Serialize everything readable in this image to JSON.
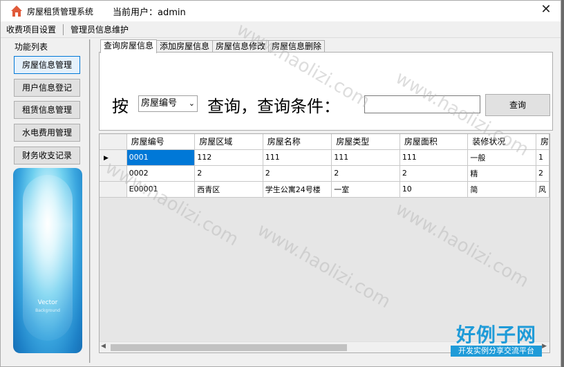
{
  "window": {
    "title": "房屋租赁管理系统",
    "user_label": "当前用户：admin",
    "close_glyph": "✕"
  },
  "menu": {
    "items": [
      "收费项目设置",
      "管理员信息维护"
    ]
  },
  "left_panel": {
    "title": "功能列表",
    "buttons": [
      "房屋信息管理",
      "用户信息登记",
      "租赁信息管理",
      "水电费用管理",
      "财务收支记录"
    ],
    "art_label": "Vector",
    "art_sublabel": "Background"
  },
  "tabs": [
    "查询房屋信息",
    "添加房屋信息",
    "房屋信息修改",
    "房屋信息删除"
  ],
  "query": {
    "prefix": "按",
    "field_selected": "房屋编号",
    "condition_label": "查询，查询条件：",
    "input_value": "",
    "button_label": "查询"
  },
  "grid": {
    "columns": [
      "房屋编号",
      "房屋区域",
      "房屋名称",
      "房屋类型",
      "房屋面积",
      "装修状况",
      "房"
    ],
    "rows": [
      [
        "0001",
        "112",
        "111",
        "111",
        "111",
        "一般",
        "1"
      ],
      [
        "0002",
        "2",
        "2",
        "2",
        "2",
        "精",
        "2"
      ],
      [
        "E00001",
        "西青区",
        "学生公寓24号楼",
        "一室",
        "10",
        "简",
        "风"
      ]
    ]
  },
  "watermark": "www.haolizi.com",
  "brand": {
    "name": "好例子网",
    "slogan": "开发实例分享交流平台"
  },
  "colors": {
    "selection": "#0078d7",
    "brand": "#1f9bd8"
  }
}
